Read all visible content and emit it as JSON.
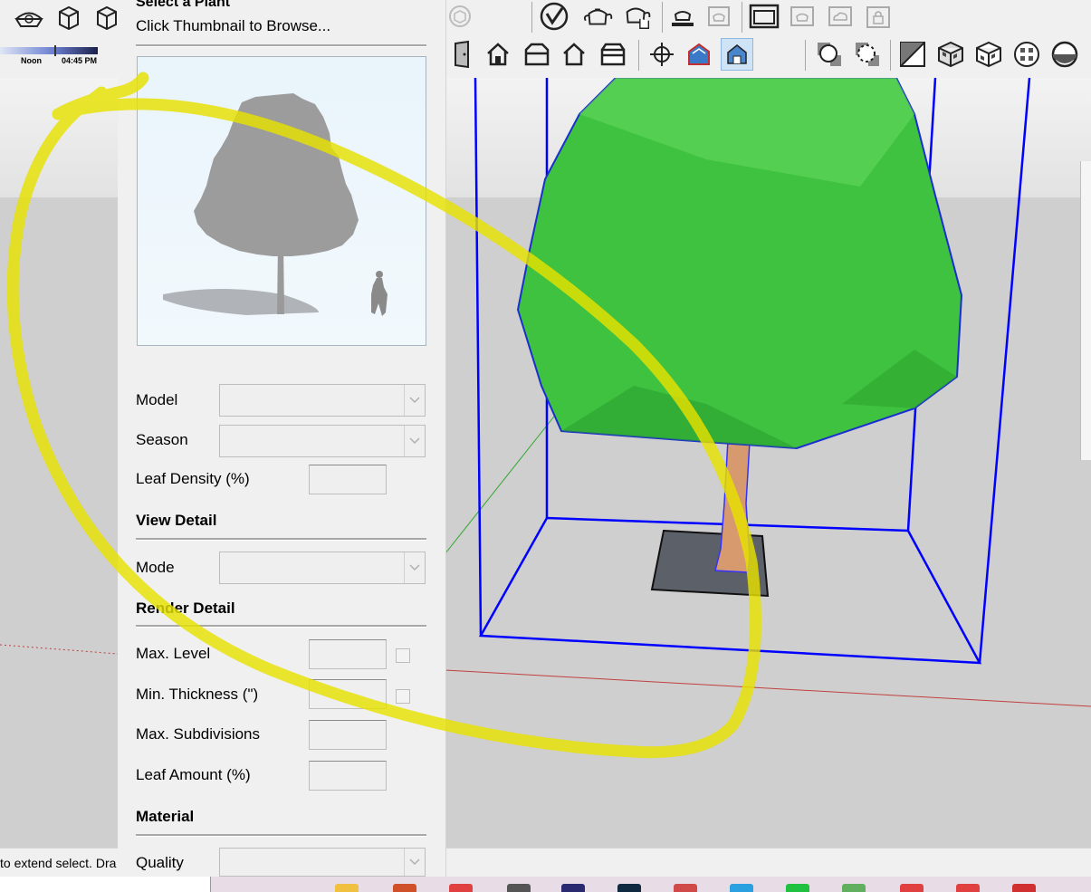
{
  "panel": {
    "title": "Select a Plant",
    "subtitle": "Click Thumbnail to Browse...",
    "fields": {
      "model_label": "Model",
      "season_label": "Season",
      "leaf_density_label": "Leaf Density (%)",
      "mode_label": "Mode",
      "max_level_label": "Max. Level",
      "min_thickness_label": "Min. Thickness (\")",
      "max_subdivisions_label": "Max. Subdivisions",
      "leaf_amount_label": "Leaf Amount (%)",
      "quality_label": "Quality"
    },
    "sections": {
      "view_detail": "View Detail",
      "render_detail": "Render Detail",
      "material": "Material"
    },
    "values": {
      "model": "",
      "season": "",
      "leaf_density": "",
      "mode": "",
      "max_level": "",
      "min_thickness": "",
      "max_subdivisions": "",
      "leaf_amount": "",
      "quality": ""
    }
  },
  "toolbar": {
    "shadow_time_left": "Noon",
    "shadow_time_right": "04:45 PM",
    "icons_row1": [
      "shadow-settings-icon",
      "push-cube-icon",
      "pull-cube-icon",
      "vray-logo-icon",
      "teapot-render-icon",
      "teapot-interactive-icon",
      "frame-buffer-icon",
      "render-region-icon",
      "vfb-window-icon",
      "teapot-cloud-icon",
      "cloud-render-icon",
      "lock-icon"
    ],
    "icons_row2": [
      "door-icon",
      "house-front-icon",
      "house-top-icon",
      "house-outline-icon",
      "house-side-icon",
      "orbit-target-icon",
      "house-xray-icon",
      "house-selected-icon",
      "sphere-shadow-icon",
      "dashed-sphere-icon",
      "checker-diagonal-icon",
      "cube-checker-icon",
      "cube-checker-2-icon",
      "checker-ball-icon",
      "half-sphere-icon"
    ]
  },
  "status": {
    "text": "to extend select. Dra"
  },
  "colors": {
    "highlight": "#e6e000",
    "foliage": "#3fc23f",
    "bbox": "#0000ff",
    "trunk": "#d69a6e"
  }
}
